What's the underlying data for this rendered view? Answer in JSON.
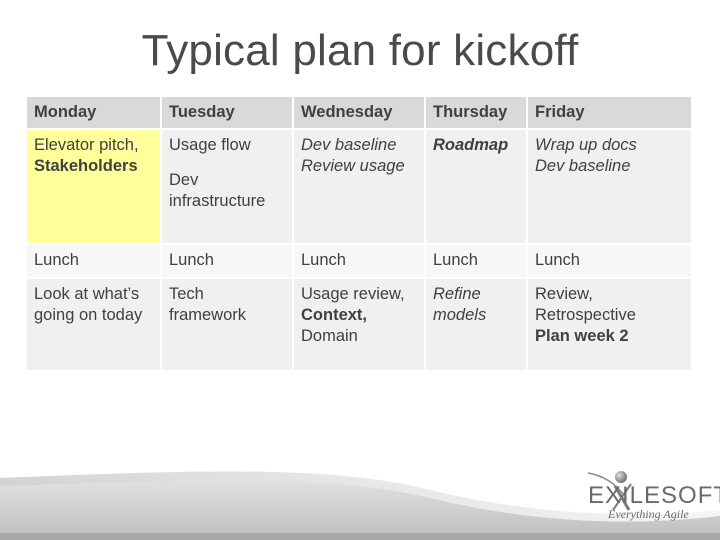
{
  "title": "Typical plan for kickoff",
  "table": {
    "headers": [
      "Monday",
      "Tuesday",
      "Wednesday",
      "Thursday",
      "Friday"
    ],
    "rows": [
      {
        "monday": {
          "line1": "Elevator pitch,",
          "line2": "Stakeholders"
        },
        "tuesday": {
          "line1": "Usage flow",
          "line2": "Dev infrastructure"
        },
        "wednesday": {
          "line1": "Dev baseline",
          "line2": "Review usage"
        },
        "thursday": {
          "line1": "Roadmap"
        },
        "friday": {
          "line1": "Wrap up docs",
          "line2": "Dev baseline"
        }
      },
      {
        "monday": {
          "line1": "Lunch"
        },
        "tuesday": {
          "line1": "Lunch"
        },
        "wednesday": {
          "line1": "Lunch"
        },
        "thursday": {
          "line1": "Lunch"
        },
        "friday": {
          "line1": "Lunch"
        }
      },
      {
        "monday": {
          "line1": "Look at what’s going on today"
        },
        "tuesday": {
          "line1": "Tech framework"
        },
        "wednesday": {
          "line1": "Usage review,",
          "line2": "Context,",
          "line3": "Domain"
        },
        "thursday": {
          "line1": "Refine models"
        },
        "friday": {
          "line1": "Review,",
          "line2": "Retrospective",
          "line3": "Plan week 2"
        }
      }
    ]
  },
  "logo": {
    "name": "EXILESOFT",
    "tagline": "Everything Agile",
    "icon": "person-figure-logo-icon"
  },
  "colors": {
    "header_bg": "#d9d9d9",
    "cell_bg": "#f0f0f0",
    "highlight_bg": "#ffff9c",
    "text": "#404040"
  }
}
